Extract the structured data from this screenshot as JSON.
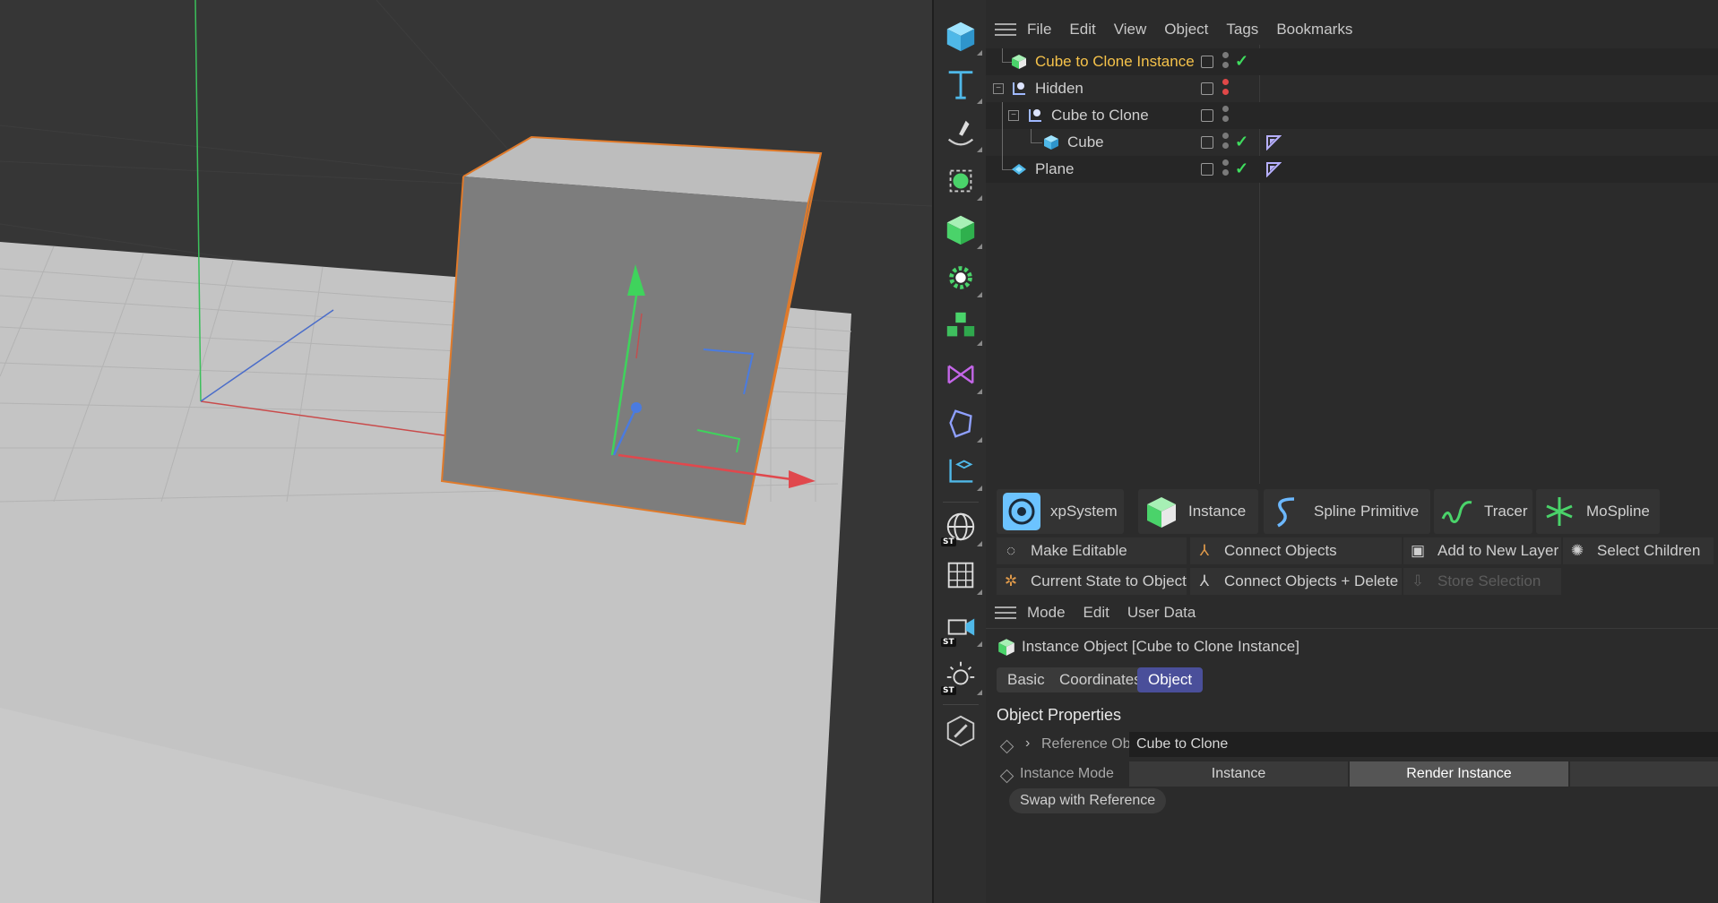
{
  "palette": {
    "tools": [
      "cube-tool",
      "text-tool",
      "pen-tool",
      "selection-tool",
      "generator-tool",
      "deformer-tool",
      "mograph-tool",
      "field-tool",
      "volume-tool",
      "scene-tool",
      "environment-tool",
      "floor-grid-tool",
      "camera-tool",
      "light-tool",
      "edit-mode-tool"
    ],
    "st_badge": "ST"
  },
  "object_manager": {
    "menu": [
      "File",
      "Edit",
      "View",
      "Object",
      "Tags",
      "Bookmarks"
    ],
    "objects": [
      {
        "name": "Cube to Clone Instance",
        "icon": "instance-icon",
        "highlighted": true,
        "check": true,
        "dots": "grey"
      },
      {
        "name": "Hidden",
        "icon": "null-icon",
        "dots": "red"
      },
      {
        "name": "Cube to Clone",
        "icon": "null-icon",
        "dots": "grey"
      },
      {
        "name": "Cube",
        "icon": "cube-icon",
        "check": true,
        "tag": true,
        "dots": "grey"
      },
      {
        "name": "Plane",
        "icon": "plane-icon",
        "check": true,
        "tag": true,
        "dots": "grey"
      }
    ]
  },
  "commander": {
    "big_buttons": [
      "xpSystem",
      "Instance",
      "Spline Primitive",
      "Tracer",
      "MoSpline"
    ],
    "commands": {
      "make_editable": "Make Editable",
      "connect_objects": "Connect Objects",
      "add_to_new_layer": "Add to New Layer",
      "select_children": "Select Children",
      "current_state": "Current State to Object",
      "connect_delete": "Connect Objects + Delete",
      "store_selection": "Store Selection"
    }
  },
  "attribute_manager": {
    "menu": [
      "Mode",
      "Edit",
      "User Data"
    ],
    "header": "Instance Object [Cube to Clone Instance]",
    "tabs": [
      "Basic",
      "Coordinates",
      "Object"
    ],
    "active_tab": "Object",
    "section_title": "Object Properties",
    "reference_label": "Reference Object",
    "reference_value": "Cube to Clone",
    "mode_label": "Instance Mode",
    "mode_options": [
      "Instance",
      "Render Instance"
    ],
    "mode_selected": "Render Instance",
    "swap_button": "Swap with Reference"
  },
  "colors": {
    "highlight_name": "#f5c24a",
    "active_tab": "#4a4f9a",
    "check": "#3fdc5e",
    "red_dot": "#e04848",
    "selection_outline": "#e07a2a"
  }
}
